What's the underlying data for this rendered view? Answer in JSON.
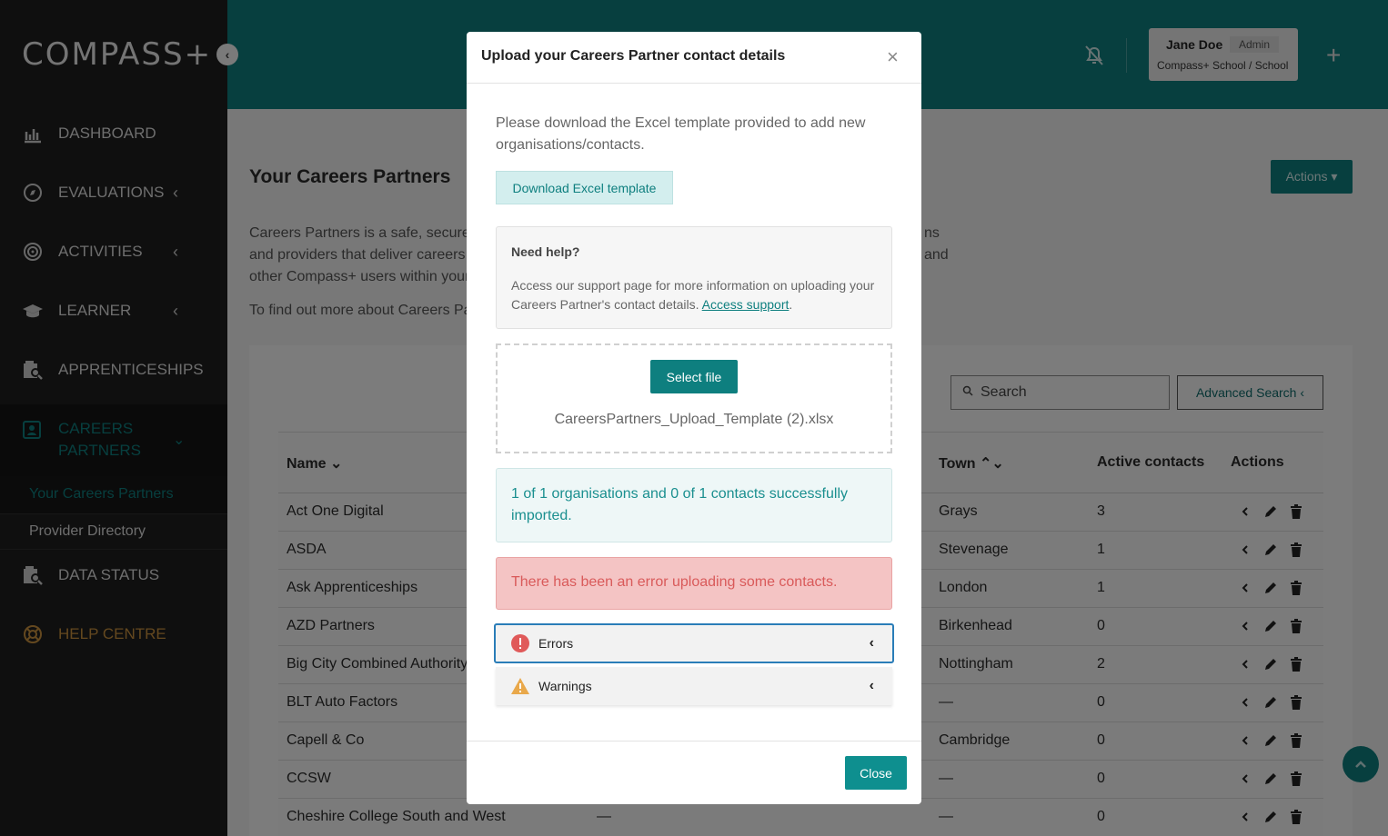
{
  "app": {
    "logo_text": "COMPASS+",
    "logo_toggle": "‹"
  },
  "sidebar": {
    "items": [
      {
        "label": "DASHBOARD",
        "icon": "chart-icon"
      },
      {
        "label": "EVALUATIONS",
        "icon": "compass-icon",
        "has_chevron": true
      },
      {
        "label": "ACTIVITIES",
        "icon": "target-icon",
        "has_chevron": true
      },
      {
        "label": "LEARNER",
        "icon": "graduation-cap-icon",
        "has_chevron": true
      },
      {
        "label": "APPRENTICESHIPS",
        "icon": "search-doc-icon"
      },
      {
        "label": "CAREERS PARTNERS",
        "icon": "contact-card-icon",
        "expanded": true
      },
      {
        "label": "DATA STATUS",
        "icon": "search-doc-icon"
      },
      {
        "label": "HELP CENTRE",
        "icon": "lifebuoy-icon"
      }
    ],
    "sub_items": [
      "Your Careers Partners",
      "Provider Directory"
    ],
    "chevron_left": "‹",
    "chevron_down": "⌄"
  },
  "header": {
    "user_name": "Jane Doe",
    "user_role": "Admin",
    "user_school": "Compass+ School  / School",
    "plus": "+"
  },
  "main": {
    "page_title": "Your Careers Partners",
    "actions_label": "Actions ▾",
    "intro_line1_left": "Careers Partners is a safe, secure",
    "intro_line1_right": "ns",
    "intro_line2_left": "and providers that deliver careers",
    "intro_line2_right": "and",
    "intro_line3_left": "other Compass+ users within your",
    "intro_more": "To find out more about Careers Pa",
    "search_placeholder": "Search",
    "advanced_search": "Advanced Search ‹",
    "columns": {
      "name": "Name ⌄",
      "town": "Town ⌃⌄",
      "active_contacts": "Active contacts",
      "actions": "Actions"
    },
    "rows": [
      {
        "name": "Act One Digital",
        "mid": "",
        "town": "Grays",
        "contacts": "3"
      },
      {
        "name": "ASDA",
        "mid": "",
        "town": "Stevenage",
        "contacts": "1"
      },
      {
        "name": "Ask Apprenticeships",
        "mid": "",
        "town": "London",
        "contacts": "1"
      },
      {
        "name": "AZD Partners",
        "mid": "",
        "town": "Birkenhead",
        "contacts": "0"
      },
      {
        "name": "Big City Combined Authority",
        "mid": "",
        "town": "Nottingham",
        "contacts": "2"
      },
      {
        "name": "BLT Auto Factors",
        "mid": "",
        "town": "—",
        "contacts": "0"
      },
      {
        "name": "Capell & Co",
        "mid": "",
        "town": "Cambridge",
        "contacts": "0"
      },
      {
        "name": "CCSW",
        "mid": "",
        "town": "—",
        "contacts": "0"
      },
      {
        "name": "Cheshire College South and West",
        "mid": "—",
        "town": "—",
        "contacts": "0"
      }
    ]
  },
  "modal": {
    "title": "Upload your Careers Partner contact details",
    "close_x": "×",
    "description": "Please download the Excel template provided to add new organisations/contacts.",
    "download_label": "Download Excel template",
    "help_title": "Need help?",
    "help_text": "Access our support page for more information on uploading your Careers Partner's contact details. ",
    "help_link": "Access support",
    "help_period": ".",
    "select_file_label": "Select file",
    "file_name": "CareersPartners_Upload_Template (2).xlsx",
    "success_message": "1 of 1 organisations and 0 of 1 contacts successfully imported.",
    "error_message": "There has been an error uploading some contacts.",
    "errors_label": "Errors",
    "warnings_label": "Warnings",
    "accordion_chevron": "‹",
    "close_label": "Close"
  },
  "colors": {
    "brand": "#0e7f7f",
    "error": "#d95a5a",
    "sidebar_bg": "#1e1e1e"
  }
}
